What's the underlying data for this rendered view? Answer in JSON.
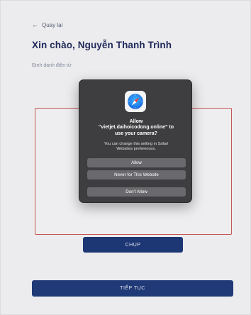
{
  "header": {
    "back_arrow": "←",
    "back_label": "Quay lại",
    "greeting": "Xin chào, Nguyễn Thanh Trình",
    "subtitle": "Định danh điện tử"
  },
  "actions": {
    "capture_label": "CHỤP",
    "continue_label": "TIẾP TỤC"
  },
  "permission_dialog": {
    "icon": "safari-compass-icon",
    "title_line1": "Allow",
    "title_line2": "“vietjet.daihoicodong.online” to",
    "title_line3": "use your camera?",
    "info_line1": "You can change this setting in Safari",
    "info_line2": "Websites preferences.",
    "allow_label": "Allow",
    "never_label": "Never for This Website",
    "deny_label": "Don’t Allow"
  },
  "colors": {
    "primary": "#223c7c",
    "frame_border": "#d05a5a",
    "dialog_bg": "#3e3e40",
    "dialog_button": "#6a6a6e"
  }
}
